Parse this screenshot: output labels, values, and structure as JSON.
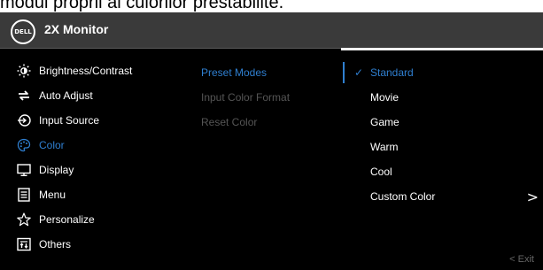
{
  "caption": "modul proprii al culorilor prestabilite.",
  "window": {
    "logo": "DELL",
    "title": "2X Monitor"
  },
  "menu": [
    {
      "label": "Brightness/Contrast",
      "icon": "brightness-icon"
    },
    {
      "label": "Auto Adjust",
      "icon": "auto-adjust-icon"
    },
    {
      "label": "Input Source",
      "icon": "input-source-icon"
    },
    {
      "label": "Color",
      "icon": "palette-icon",
      "active": true
    },
    {
      "label": "Display",
      "icon": "display-icon"
    },
    {
      "label": "Menu",
      "icon": "menu-icon"
    },
    {
      "label": "Personalize",
      "icon": "star-icon"
    },
    {
      "label": "Others",
      "icon": "others-icon"
    }
  ],
  "submenu": [
    {
      "label": "Preset Modes",
      "active": true
    },
    {
      "label": "Input Color Format",
      "active": false
    },
    {
      "label": "Reset Color",
      "active": false
    }
  ],
  "options": [
    {
      "label": "Standard",
      "selected": true
    },
    {
      "label": "Movie",
      "selected": false
    },
    {
      "label": "Game",
      "selected": false
    },
    {
      "label": "Warm",
      "selected": false
    },
    {
      "label": "Cool",
      "selected": false
    },
    {
      "label": "Custom Color",
      "selected": false
    }
  ],
  "exit_label": "< Exit",
  "colors": {
    "accent": "#2f7fd0",
    "background": "#000000",
    "titlebar": "#3a3a3a",
    "disabled": "#555555"
  }
}
